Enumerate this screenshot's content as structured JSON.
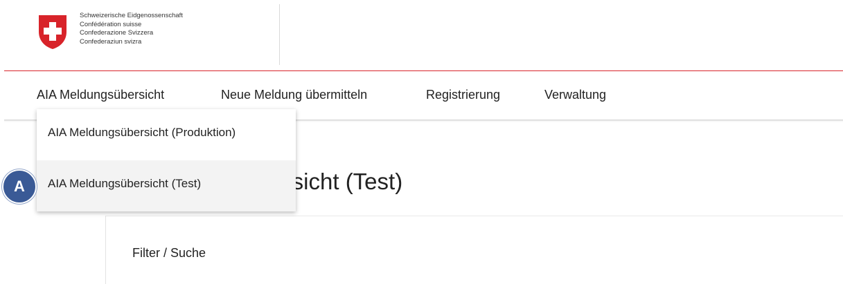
{
  "header": {
    "crest_icon": "swiss-coat-of-arms-icon",
    "federal_names": [
      "Schweizerische Eidgenossenschaft",
      "Confédération suisse",
      "Confederazione Svizzera",
      "Confederaziun svizra"
    ],
    "brand_color": "#d8232a"
  },
  "nav": {
    "items": [
      {
        "label": "AIA Meldungsübersicht"
      },
      {
        "label": "Neue Meldung übermitteln"
      },
      {
        "label": "Registrierung"
      },
      {
        "label": "Verwaltung"
      }
    ]
  },
  "dropdown": {
    "items": [
      {
        "label": "AIA Meldungsübersicht (Produktion)"
      },
      {
        "label": "AIA Meldungsübersicht (Test)"
      }
    ]
  },
  "page": {
    "title": "AIA Meldungsübersicht (Test)",
    "filter_heading": "Filter / Suche"
  },
  "annotation": {
    "marker_label": "A",
    "marker_color": "#3a5a96"
  }
}
